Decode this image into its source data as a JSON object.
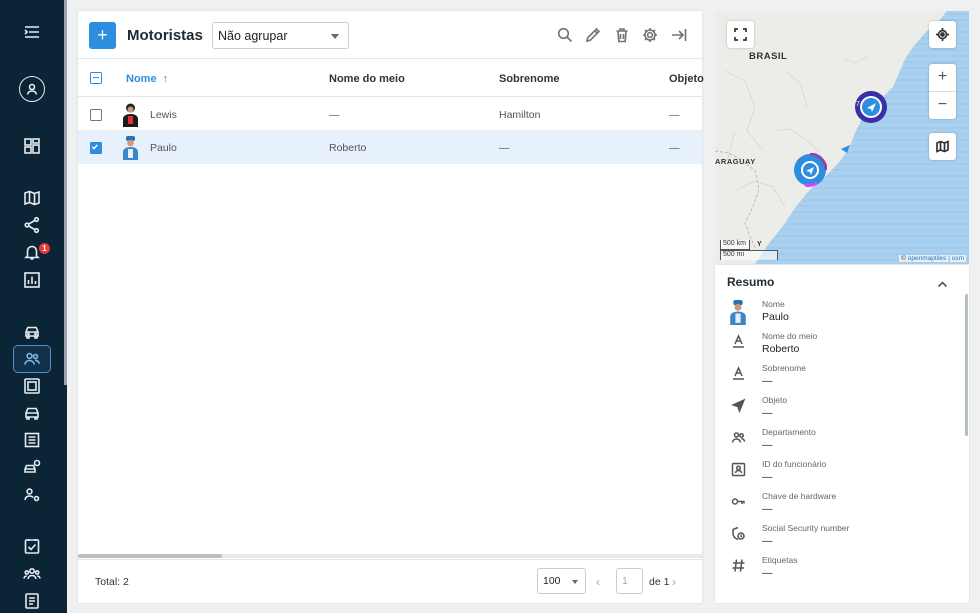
{
  "nav": {
    "notification_count": "1"
  },
  "toolbar": {
    "add_label": "+",
    "title": "Motoristas",
    "group_by": "Não agrupar"
  },
  "table": {
    "columns": [
      "Nome",
      "Nome do meio",
      "Sobrenome",
      "Objeto"
    ],
    "sorted_column": "Nome",
    "sort_direction": "ascending",
    "rows": [
      {
        "name": "Lewis",
        "middle_name": "—",
        "surname": "Hamilton",
        "object": "—",
        "selected": false
      },
      {
        "name": "Paulo",
        "middle_name": "Roberto",
        "surname": "—",
        "object": "—",
        "selected": true
      }
    ]
  },
  "footer": {
    "total": "Total: 2",
    "page_size": "100",
    "page_input": "1",
    "page_of": "de 1"
  },
  "map": {
    "label_brasil": "BRASIL",
    "label_paraguay": "ARAGUAY",
    "label_y": "Y",
    "cluster_small": "7",
    "scale_km": "500 km",
    "scale_mi": "500 mi",
    "attribution_prefix": "©",
    "attribution_links": "openmaptiles | osm"
  },
  "summary": {
    "title": "Resumo",
    "fields": [
      {
        "label": "Nome",
        "value": "Paulo",
        "icon": "driver-avatar"
      },
      {
        "label": "Nome do meio",
        "value": "Roberto",
        "icon": "text-a-icon"
      },
      {
        "label": "Sobrenome",
        "value": "—",
        "icon": "text-a-icon"
      },
      {
        "label": "Objeto",
        "value": "—",
        "icon": "navigation-arrow-icon"
      },
      {
        "label": "Departamento",
        "value": "—",
        "icon": "people-icon"
      },
      {
        "label": "ID do funcionário",
        "value": "—",
        "icon": "id-card-icon"
      },
      {
        "label": "Chave de hardware",
        "value": "—",
        "icon": "key-icon"
      },
      {
        "label": "Social Security number",
        "value": "—",
        "icon": "shield-icon"
      },
      {
        "label": "Etiquetas",
        "value": "—",
        "icon": "hash-icon"
      }
    ]
  },
  "colors": {
    "rail_bg": "#0b2436",
    "accent": "#2d8ee0",
    "selected_row": "#e7f1fb",
    "sea": "#a9d0ee"
  }
}
